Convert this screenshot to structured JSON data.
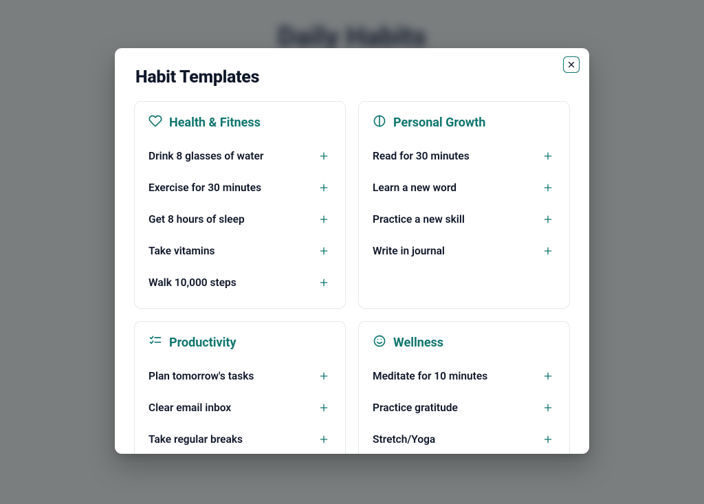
{
  "background_title": "Daily Habits",
  "modal": {
    "title": "Habit Templates",
    "close_aria": "Close"
  },
  "categories": [
    {
      "icon": "heart-icon",
      "title": "Health & Fitness",
      "items": [
        "Drink 8 glasses of water",
        "Exercise for 30 minutes",
        "Get 8 hours of sleep",
        "Take vitamins",
        "Walk 10,000 steps"
      ]
    },
    {
      "icon": "split-circle-icon",
      "title": "Personal Growth",
      "items": [
        "Read for 30 minutes",
        "Learn a new word",
        "Practice a new skill",
        "Write in journal"
      ]
    },
    {
      "icon": "checklist-icon",
      "title": "Productivity",
      "items": [
        "Plan tomorrow's tasks",
        "Clear email inbox",
        "Take regular breaks"
      ]
    },
    {
      "icon": "smile-icon",
      "title": "Wellness",
      "items": [
        "Meditate for 10 minutes",
        "Practice gratitude",
        "Stretch/Yoga"
      ]
    }
  ]
}
